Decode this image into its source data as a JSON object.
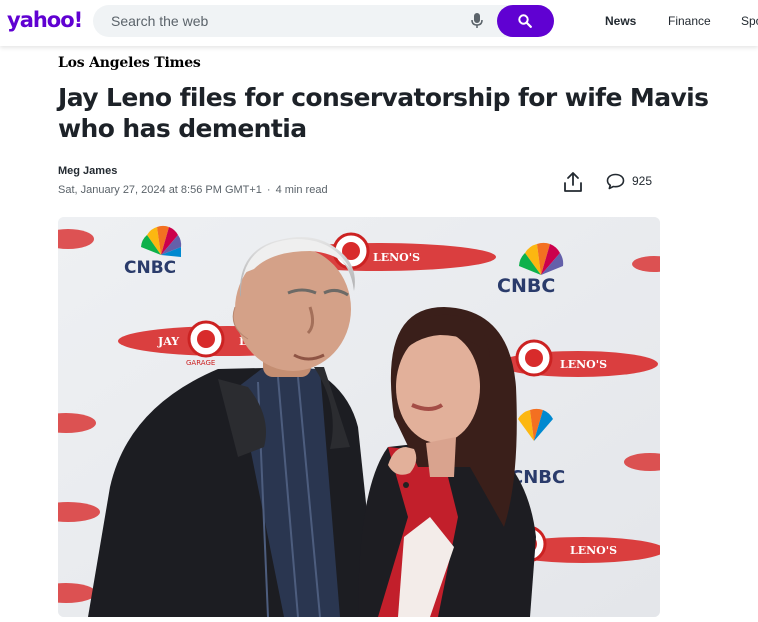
{
  "header": {
    "logo": "yahoo!",
    "search": {
      "placeholder": "Search the web",
      "value": ""
    },
    "nav": [
      "News",
      "Finance",
      "Spo"
    ],
    "active_nav": "News"
  },
  "article": {
    "source": "Los Angeles Times",
    "headline": "Jay Leno files for conservatorship for wife Mavis who has dementia",
    "author": "Meg James",
    "date": "Sat, January 27, 2024 at 8:56 PM GMT+1",
    "separator": "·",
    "read_time": "4 min read",
    "comment_count": "925"
  },
  "photo": {
    "backdrop_logos": [
      "CNBC",
      "JAY",
      "LENO'S",
      "GARAGE"
    ]
  },
  "colors": {
    "brand": "#6001d2",
    "text": "#232a31",
    "muted": "#5b636a"
  },
  "icons": [
    "mic-icon",
    "search-icon",
    "share-icon",
    "comment-icon"
  ]
}
